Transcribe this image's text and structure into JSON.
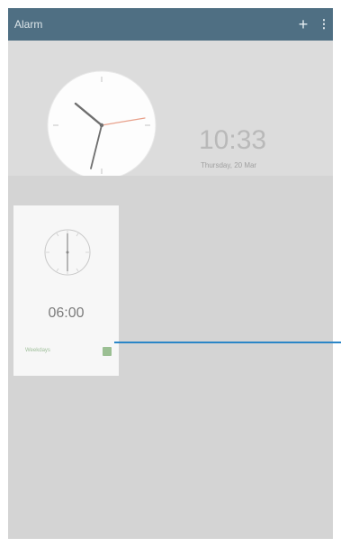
{
  "app": {
    "title": "Alarm"
  },
  "actionbar": {
    "add_icon": "+",
    "menu_icon": "⋮"
  },
  "world_clock": {
    "time": "10:33",
    "date": "Thursday, 20 Mar"
  },
  "alarm": {
    "time": "06:00",
    "label": "Weekdays",
    "enabled": true
  },
  "colors": {
    "actionbar": "#4f6f83",
    "accent_hand": "#e8a08a",
    "toggle_on": "#9bbf93",
    "callout": "#2b86c7"
  }
}
